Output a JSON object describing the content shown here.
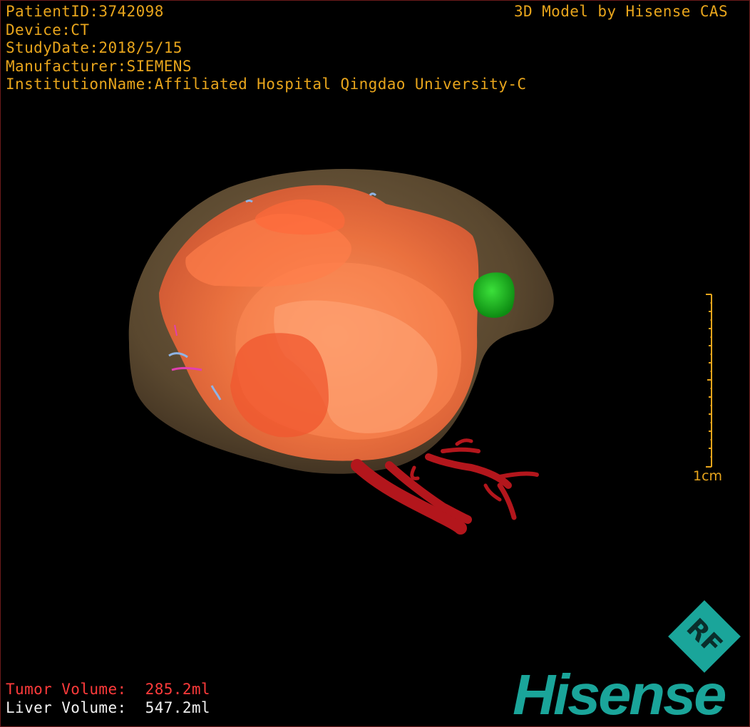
{
  "info": {
    "patient_id": "PatientID:3742098",
    "device": "Device:CT",
    "study_date": "StudyDate:2018/5/15",
    "manufacturer": "Manufacturer:SIEMENS",
    "institution": "InstitutionName:Affiliated Hospital Qingdao University-C"
  },
  "credit": "3D Model by Hisense CAS",
  "scale_bar": {
    "label": "1cm"
  },
  "volumes": {
    "tumor_label": "Tumor Volume:",
    "tumor_value": "285.2ml",
    "liver_label": "Liver Volume:",
    "liver_value": "547.2ml"
  },
  "brand": {
    "badge_text": "RF",
    "name": "Hisense",
    "color": "#1aa59a"
  },
  "colors": {
    "overlay_text": "#e8a51c",
    "tumor_text": "#ff3b3b",
    "liver_text": "#f2f2f2",
    "liver": "#6b5638",
    "tumor": "#f0703f",
    "vessels": "#b3161c",
    "lesion": "#16b41a",
    "portal": "#8fb4e6"
  },
  "icons": {
    "rf_badge": "rf-diamond-icon"
  }
}
